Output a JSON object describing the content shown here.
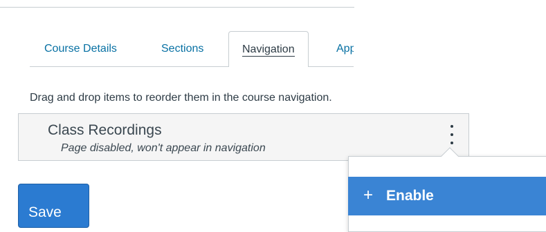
{
  "tabs": [
    {
      "label": "Course Details",
      "active": false
    },
    {
      "label": "Sections",
      "active": false
    },
    {
      "label": "Navigation",
      "active": true
    },
    {
      "label": "Apps",
      "active": false
    }
  ],
  "instructions": "Drag and drop items to reorder them in the course navigation.",
  "nav_item": {
    "title": "Class Recordings",
    "subtitle": "Page disabled, won't appear in navigation",
    "menu_icon": "kebab-vertical-icon"
  },
  "menu": {
    "items": [
      {
        "icon": "plus-icon",
        "glyph": "+",
        "label": "Enable"
      }
    ]
  },
  "save_button": {
    "label": "Save"
  },
  "colors": {
    "link": "#0770a3",
    "primary": "#2b7bd1",
    "menu_highlight": "#3a84d4",
    "item_bg": "#f5f5f5",
    "border": "#c7cdd1",
    "text": "#2d3b45"
  }
}
